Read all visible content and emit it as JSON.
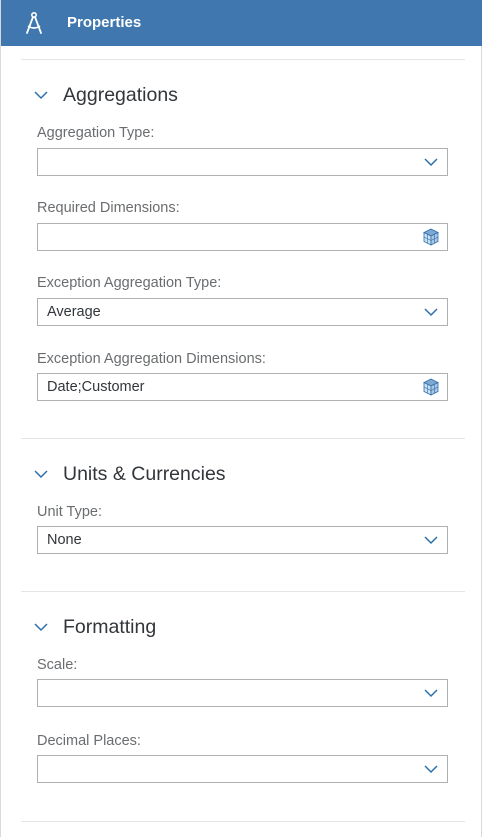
{
  "header": {
    "title": "Properties",
    "icon": "compass-icon"
  },
  "sections": {
    "aggregations": {
      "title": "Aggregations",
      "aggregation_type": {
        "label": "Aggregation Type:",
        "value": ""
      },
      "required_dimensions": {
        "label": "Required Dimensions:",
        "value": ""
      },
      "exception_aggregation_type": {
        "label": "Exception Aggregation Type:",
        "value": "Average"
      },
      "exception_aggregation_dimensions": {
        "label": "Exception Aggregation Dimensions:",
        "value": "Date;Customer"
      }
    },
    "units": {
      "title": "Units & Currencies",
      "unit_type": {
        "label": "Unit Type:",
        "value": "None"
      }
    },
    "formatting": {
      "title": "Formatting",
      "scale": {
        "label": "Scale:",
        "value": ""
      },
      "decimal_places": {
        "label": "Decimal Places:",
        "value": ""
      }
    }
  },
  "colors": {
    "header_bg": "#3f77ae",
    "accent": "#2c6fad",
    "text": "#32363a",
    "label": "#6a6d70"
  }
}
